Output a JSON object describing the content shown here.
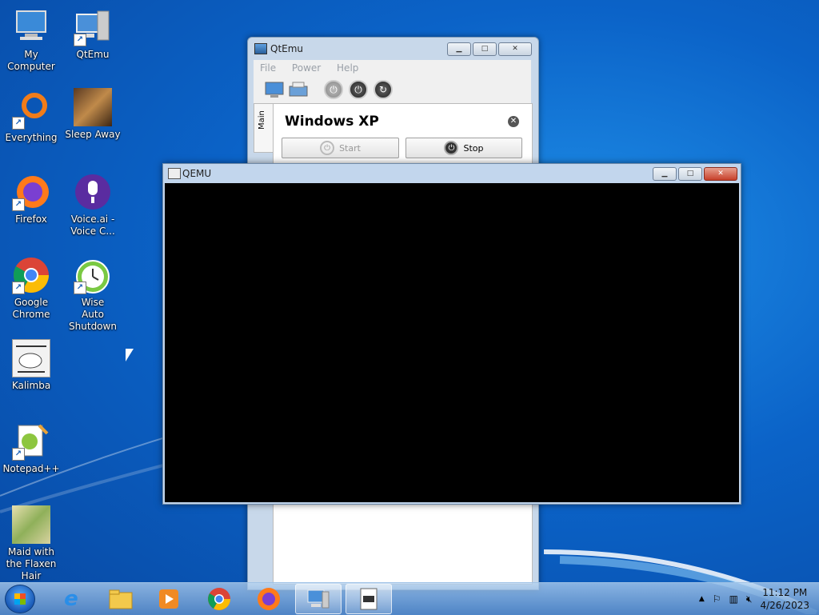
{
  "desktop": {
    "icons": [
      {
        "label": "My Computer",
        "icon": "computer-icon"
      },
      {
        "label": "QtEmu",
        "icon": "qtemu-icon"
      },
      {
        "label": "Everything",
        "icon": "everything-icon"
      },
      {
        "label": "Sleep Away",
        "icon": "album-art-icon"
      },
      {
        "label": "Firefox",
        "icon": "firefox-icon"
      },
      {
        "label": "Voice.ai - Voice C...",
        "icon": "voiceai-icon"
      },
      {
        "label": "Google Chrome",
        "icon": "chrome-icon"
      },
      {
        "label": "Wise Auto Shutdown",
        "icon": "wise-shutdown-icon"
      },
      {
        "label": "Kalimba",
        "icon": "album-art-icon"
      },
      {
        "label": "Notepad++",
        "icon": "notepadpp-icon"
      },
      {
        "label": "Maid with the Flaxen Hair",
        "icon": "album-art-icon"
      }
    ]
  },
  "qtemu_window": {
    "title": "QtEmu",
    "menu": [
      "File",
      "Power",
      "Help"
    ],
    "side_tab": "Main",
    "vm_name": "Windows XP",
    "start_label": "Start",
    "stop_label": "Stop"
  },
  "qemu_window": {
    "title": "QEMU"
  },
  "taskbar": {
    "time": "11:12 PM",
    "date": "4/26/2023"
  },
  "colors": {
    "desktop": "#0b63c8",
    "vm_screen": "#000000"
  }
}
